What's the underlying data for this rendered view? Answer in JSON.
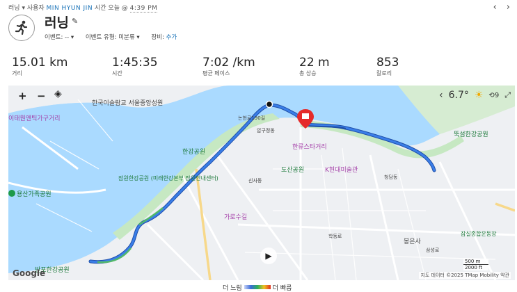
{
  "breadcrumb": {
    "activity_type": "러닝",
    "user_prefix": "사용자",
    "user_name": "MIN HYUN JIN",
    "time_prefix": "시간 오늘 @",
    "time": "4:39 PM"
  },
  "activity": {
    "title": "러닝",
    "event_label": "이벤트: --",
    "event_type_label": "이벤트 유형: 미분류",
    "gear_label": "장비:",
    "gear_link": "추가",
    "icon": "running-person-icon"
  },
  "stats": [
    {
      "value": "15.01 km",
      "label": "거리"
    },
    {
      "value": "1:45:35",
      "label": "시간"
    },
    {
      "value": "7:02 /km",
      "label": "평균 페이스"
    },
    {
      "value": "22 m",
      "label": "총 상승"
    },
    {
      "value": "853",
      "label": "칼로리"
    }
  ],
  "map": {
    "zoom_in": "+",
    "zoom_out": "−",
    "temperature": "6.7°",
    "wind": "9",
    "scale_500": "500 m",
    "scale_2000": "2000 ft",
    "attribution": "지도 데이터 ©2025 TMap Mobility   약관",
    "google": "Google",
    "labels": {
      "hannamdong": "한국이슬람교 서울중앙성원",
      "itaewon": "이태원앤틱가구거리",
      "yongsan": "용산가족공원",
      "hangang_park": "한강공원",
      "jamwon": "잠원한강공원 (미래한강본부 잠원안내센터)",
      "banpo": "반포한강공원",
      "hallyu": "한류스타거리",
      "dosan": "도산공원",
      "khyundai": "K현대미술관",
      "garosu": "가로수길",
      "ttukseom": "뚝섬한강공원",
      "bongeunsa": "봉은사",
      "jamsil": "잠실종합운동장",
      "nonhyeon190": "논현로190길",
      "apgujeong": "압구정동",
      "sinsa": "신사동",
      "cheongdam": "청담동",
      "hakdong": "학동로",
      "samseong": "삼성로"
    }
  },
  "legend": {
    "slow": "더 느림",
    "fast": "더 빠름"
  },
  "colors": {
    "route": "#2a6fd6",
    "water": "#aadaff",
    "park": "#c6e8c2",
    "accent": "#1a73b8",
    "pin": "#e52b2b"
  }
}
